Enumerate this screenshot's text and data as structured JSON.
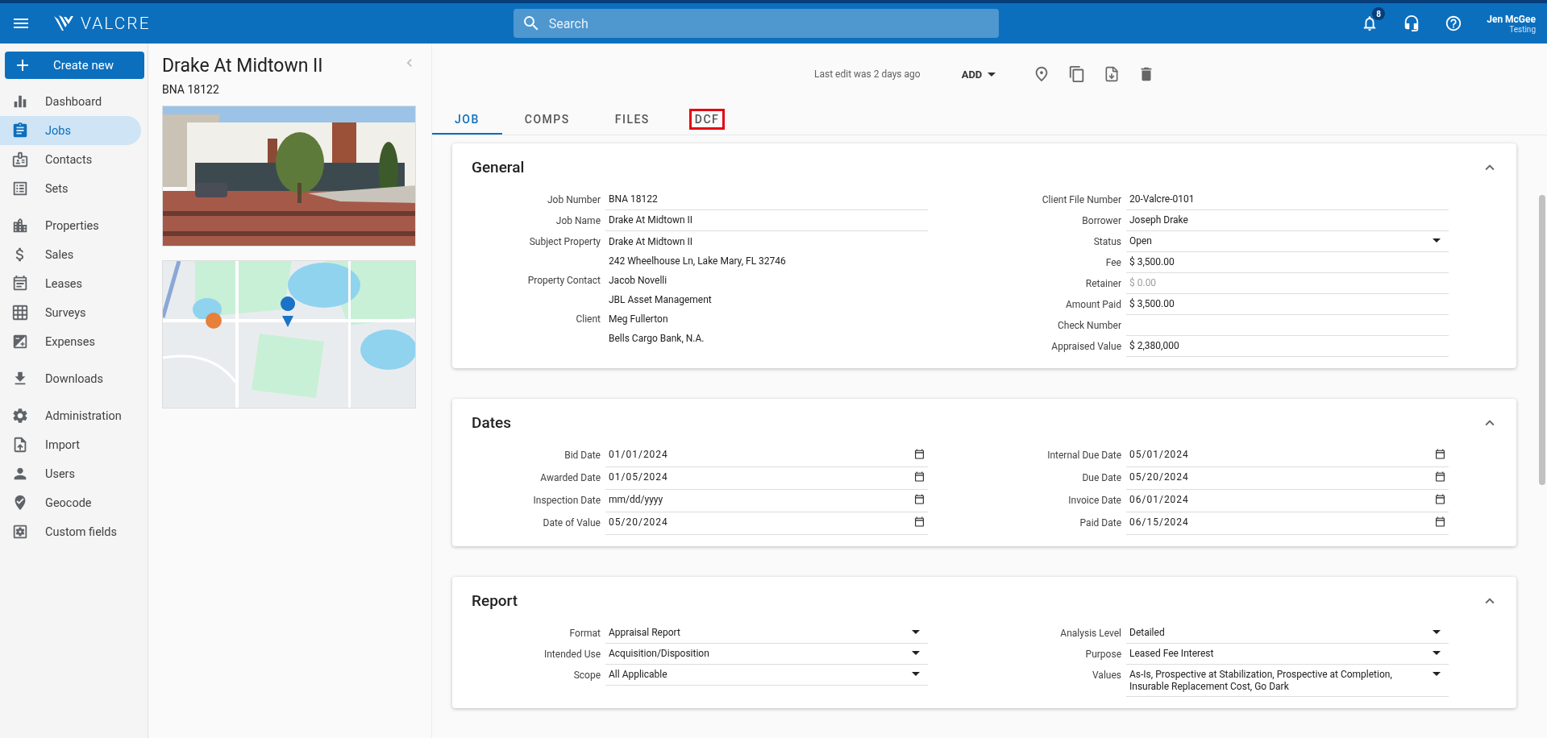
{
  "topbar": {
    "logo": "VALCRE",
    "search": {
      "placeholder": "Search"
    },
    "notifications": "8",
    "user": {
      "name": "Jen McGee",
      "role": "Testing"
    }
  },
  "sidebar": {
    "create_button": "Create new",
    "groups": [
      [
        {
          "label": "Dashboard",
          "selected": false
        },
        {
          "label": "Jobs",
          "selected": true
        },
        {
          "label": "Contacts",
          "selected": false
        },
        {
          "label": "Sets",
          "selected": false
        }
      ],
      [
        {
          "label": "Properties",
          "selected": false
        },
        {
          "label": "Sales",
          "selected": false
        },
        {
          "label": "Leases",
          "selected": false
        },
        {
          "label": "Surveys",
          "selected": false
        },
        {
          "label": "Expenses",
          "selected": false
        }
      ],
      [
        {
          "label": "Downloads",
          "selected": false
        }
      ],
      [
        {
          "label": "Administration",
          "selected": false
        },
        {
          "label": "Import",
          "selected": false
        },
        {
          "label": "Users",
          "selected": false
        },
        {
          "label": "Geocode",
          "selected": false
        },
        {
          "label": "Custom fields",
          "selected": false
        }
      ]
    ]
  },
  "job_panel": {
    "title": "Drake At Midtown II",
    "subtitle": "BNA 18122"
  },
  "toolbar": {
    "last_edit": "Last edit was 2 days ago",
    "add_button": "ADD"
  },
  "tabs": [
    {
      "label": "JOB",
      "selected": true,
      "outlined": false
    },
    {
      "label": "COMPS",
      "selected": false,
      "outlined": false
    },
    {
      "label": "FILES",
      "selected": false,
      "outlined": false
    },
    {
      "label": "DCF",
      "selected": false,
      "outlined": true
    }
  ],
  "sections": [
    {
      "title": "General",
      "expanded": true,
      "columns": [
        [
          {
            "kind": "text",
            "label": "Job Number",
            "value": "BNA 18122"
          },
          {
            "kind": "text",
            "label": "Job Name",
            "value": "Drake At Midtown II"
          },
          {
            "kind": "lines",
            "label": "Subject Property",
            "lines": [
              "Drake At Midtown II",
              "242 Wheelhouse Ln, Lake Mary, FL 32746"
            ]
          },
          {
            "kind": "lines",
            "label": "Property Contact",
            "lines": [
              "Jacob Novelli",
              "JBL Asset Management"
            ]
          },
          {
            "kind": "lines",
            "label": "Client",
            "lines": [
              "Meg Fullerton",
              "Bells Cargo Bank, N.A."
            ]
          }
        ],
        [
          {
            "kind": "text",
            "label": "Client File Number",
            "value": "20-Valcre-0101"
          },
          {
            "kind": "text",
            "label": "Borrower",
            "value": "Joseph Drake"
          },
          {
            "kind": "select",
            "label": "Status",
            "value": "Open"
          },
          {
            "kind": "text",
            "label": "Fee",
            "value": "$ 3,500.00"
          },
          {
            "kind": "text",
            "label": "Retainer",
            "placeholder": "$ 0.00"
          },
          {
            "kind": "text",
            "label": "Amount Paid",
            "value": "$ 3,500.00"
          },
          {
            "kind": "text",
            "label": "Check Number"
          },
          {
            "kind": "text",
            "label": "Appraised Value",
            "value": "$ 2,380,000"
          }
        ]
      ]
    },
    {
      "title": "Dates",
      "expanded": true,
      "columns": [
        [
          {
            "kind": "date",
            "label": "Bid Date",
            "value": "01/01/2024"
          },
          {
            "kind": "date",
            "label": "Awarded Date",
            "value": "01/05/2024"
          },
          {
            "kind": "date",
            "label": "Inspection Date",
            "placeholder": "mm/dd/yyyy"
          },
          {
            "kind": "date",
            "label": "Date of Value",
            "value": "05/20/2024"
          }
        ],
        [
          {
            "kind": "date",
            "label": "Internal Due Date",
            "value": "05/01/2024"
          },
          {
            "kind": "date",
            "label": "Due Date",
            "value": "05/20/2024"
          },
          {
            "kind": "date",
            "label": "Invoice Date",
            "value": "06/01/2024"
          },
          {
            "kind": "date",
            "label": "Paid Date",
            "value": "06/15/2024"
          }
        ]
      ]
    },
    {
      "title": "Report",
      "expanded": true,
      "columns": [
        [
          {
            "kind": "select",
            "label": "Format",
            "value": "Appraisal Report"
          },
          {
            "kind": "select",
            "label": "Intended Use",
            "value": "Acquisition/Disposition"
          },
          {
            "kind": "select",
            "label": "Scope",
            "value": "All Applicable"
          }
        ],
        [
          {
            "kind": "select",
            "label": "Analysis Level",
            "value": "Detailed"
          },
          {
            "kind": "select",
            "label": "Purpose",
            "value": "Leased Fee Interest"
          },
          {
            "kind": "select",
            "label": "Values",
            "value": "As-Is, Prospective at Stabilization, Prospective at Completion, Insurable Replacement Cost, Go Dark"
          }
        ]
      ]
    }
  ]
}
